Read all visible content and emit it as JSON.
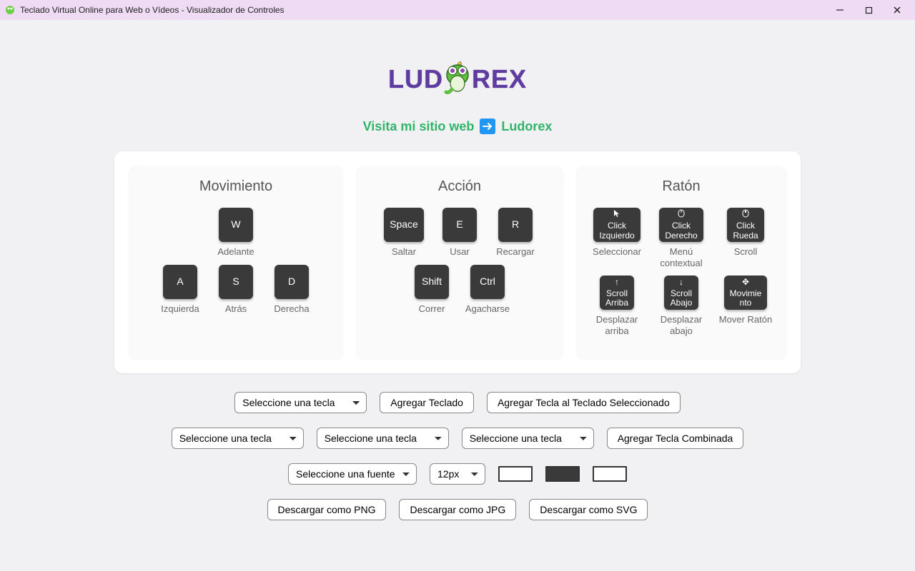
{
  "window": {
    "title": "Teclado Virtual Online para Web o Vídeos - Visualizador de Controles"
  },
  "logo": {
    "left": "LUD",
    "right": "REX"
  },
  "visit": {
    "prefix": "Visita mi sitio web",
    "name": "Ludorex"
  },
  "sections": {
    "movement": {
      "title": "Movimiento",
      "keys": {
        "w": {
          "label": "W",
          "caption": "Adelante"
        },
        "a": {
          "label": "A",
          "caption": "Izquierda"
        },
        "s": {
          "label": "S",
          "caption": "Atrás"
        },
        "d": {
          "label": "D",
          "caption": "Derecha"
        }
      }
    },
    "action": {
      "title": "Acción",
      "keys": {
        "space": {
          "label": "Space",
          "caption": "Saltar"
        },
        "e": {
          "label": "E",
          "caption": "Usar"
        },
        "r": {
          "label": "R",
          "caption": "Recargar"
        },
        "shift": {
          "label": "Shift",
          "caption": "Correr"
        },
        "ctrl": {
          "label": "Ctrl",
          "caption": "Agacharse"
        }
      }
    },
    "mouse": {
      "title": "Ratón",
      "keys": {
        "lclick": {
          "line1": "Click",
          "line2": "Izquierdo",
          "caption": "Seleccionar"
        },
        "rclick": {
          "line1": "Click",
          "line2": "Derecho",
          "caption": "Menú contextual"
        },
        "wclick": {
          "line1": "Click",
          "line2": "Rueda",
          "caption": "Scroll"
        },
        "sup": {
          "line1": "Scroll",
          "line2": "Arriba",
          "caption": "Desplazar arriba"
        },
        "sdown": {
          "line1": "Scroll",
          "line2": "Abajo",
          "caption": "Desplazar abajo"
        },
        "move": {
          "line1": "Movimie",
          "line2": "nto",
          "caption": "Mover Ratón"
        }
      }
    }
  },
  "controls": {
    "selectKey": "Seleccione una tecla",
    "addKeyboard": "Agregar Teclado",
    "addKeyToSel": "Agregar Tecla al Teclado Seleccionado",
    "addCombined": "Agregar Tecla Combinada",
    "selectFont": "Seleccione una fuente",
    "fontSize": "12px",
    "dlPng": "Descargar como PNG",
    "dlJpg": "Descargar como JPG",
    "dlSvg": "Descargar como SVG"
  },
  "colors": {
    "swatch1": "#ffffff",
    "swatch2": "#3a3a3a",
    "swatch3": "#ffffff"
  }
}
